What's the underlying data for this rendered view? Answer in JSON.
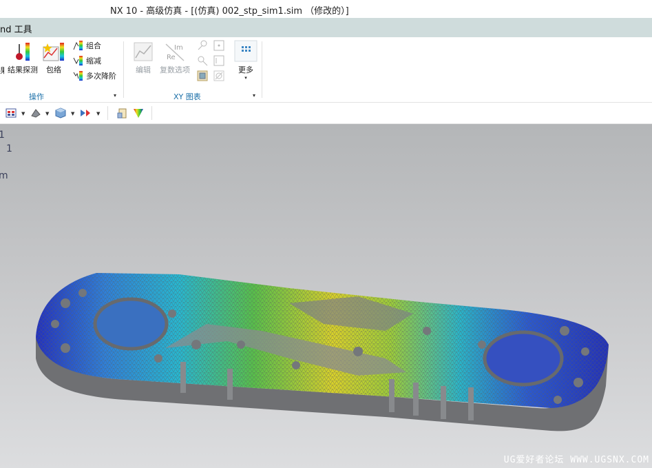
{
  "window": {
    "title": "NX 10 - 高级仿真 - [(仿真) 002_stp_sim1.sim （修改的）]"
  },
  "ribbon_tab": {
    "label": "nd 工具"
  },
  "ribbon": {
    "operations_group": {
      "label": "操作",
      "result_probe_label": "结果探测",
      "envelope_label": "包络",
      "cut_partial_label": "果",
      "combine_label": "组合",
      "reduce_label": "缩减",
      "multi_descent_label": "多次降阶"
    },
    "xy_group": {
      "label": "XY 图表",
      "edit_label": "编辑",
      "complex_options_label": "复数选项",
      "more_label": "更多"
    }
  },
  "viewport": {
    "overlay_line1": "1",
    "overlay_line2": "1",
    "overlay_line3": "m",
    "watermark": "UG爱好者论坛 WWW.UGSNX.COM"
  },
  "colors": {
    "ribbon_tab_bg": "#cfdcdc",
    "group_label": "#1b6fa8",
    "mesh_gray": "#6f7073"
  }
}
